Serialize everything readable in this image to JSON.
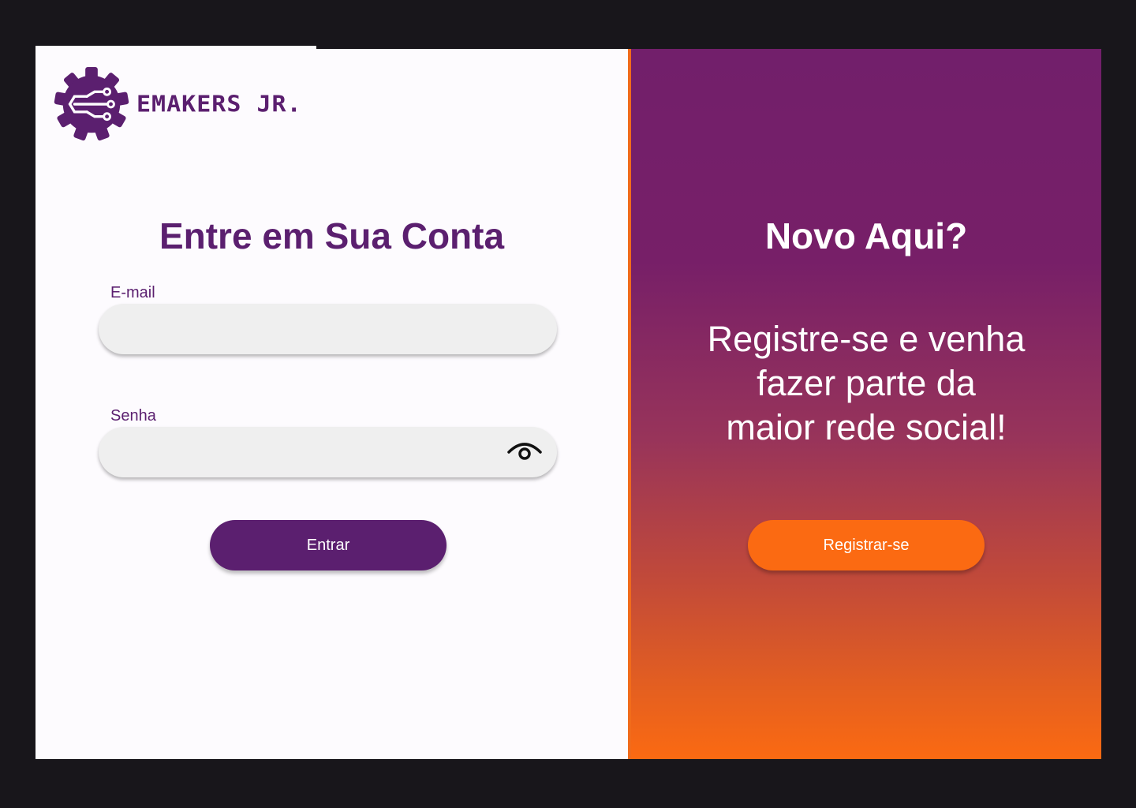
{
  "brand": {
    "logo_text": "EMAKERS JR.",
    "logo_icon": "gear-circuit-icon",
    "primary_color": "#5b1f6f",
    "accent_color": "#fb6a12"
  },
  "login": {
    "title": "Entre em Sua Conta",
    "email_label": "E-mail",
    "email_value": "",
    "password_label": "Senha",
    "password_value": "",
    "password_toggle_icon": "eye-icon",
    "submit_label": "Entrar"
  },
  "register": {
    "title": "Novo Aqui?",
    "line1": "Registre-se e venha",
    "line2": "fazer parte da",
    "line3": "maior rede social!",
    "button_label": "Registrar-se",
    "gradient_top": "#721f6b",
    "gradient_bottom": "#fb6a12"
  }
}
